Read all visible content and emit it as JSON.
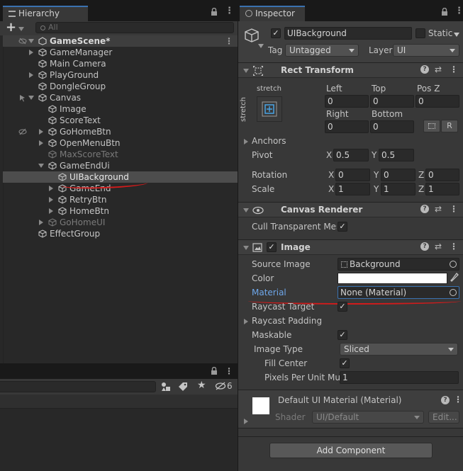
{
  "hierarchy": {
    "tab_label": "Hierarchy",
    "search_placeholder": "All",
    "scene_name": "GameScene*",
    "items": [
      {
        "label": "GameManager"
      },
      {
        "label": "Main Camera"
      },
      {
        "label": "PlayGround"
      },
      {
        "label": "DongleGroup"
      },
      {
        "label": "Canvas"
      },
      {
        "label": "Image"
      },
      {
        "label": "ScoreText"
      },
      {
        "label": "GoHomeBtn"
      },
      {
        "label": "OpenMenuBtn"
      },
      {
        "label": "MaxScoreText"
      },
      {
        "label": "GameEndUi"
      },
      {
        "label": "UIBackground"
      },
      {
        "label": "GameEnd"
      },
      {
        "label": "RetryBtn"
      },
      {
        "label": "HomeBtn"
      },
      {
        "label": "GoHomeUI"
      },
      {
        "label": "EffectGroup"
      }
    ]
  },
  "project": {
    "hidden_count": "6"
  },
  "inspector": {
    "tab_label": "Inspector",
    "object_name": "UIBackground",
    "static_label": "Static",
    "tag_label": "Tag",
    "tag_value": "Untagged",
    "layer_label": "Layer",
    "layer_value": "UI",
    "rect_transform": {
      "title": "Rect Transform",
      "anchor_preset_top": "stretch",
      "anchor_preset_side": "stretch",
      "left_label": "Left",
      "left": "0",
      "top_label": "Top",
      "top": "0",
      "posz_label": "Pos Z",
      "posz": "0",
      "right_label": "Right",
      "right": "0",
      "bottom_label": "Bottom",
      "bottom": "0",
      "r_button": "R",
      "anchors_label": "Anchors",
      "pivot_label": "Pivot",
      "pivot_x": "0.5",
      "pivot_y": "0.5",
      "rotation_label": "Rotation",
      "rot_x": "0",
      "rot_y": "0",
      "rot_z": "0",
      "scale_label": "Scale",
      "scale_x": "1",
      "scale_y": "1",
      "scale_z": "1",
      "axis_x": "X",
      "axis_y": "Y",
      "axis_z": "Z"
    },
    "canvas_renderer": {
      "title": "Canvas Renderer",
      "cull_label": "Cull Transparent Mes"
    },
    "image": {
      "title": "Image",
      "source_label": "Source Image",
      "source_value": "Background",
      "color_label": "Color",
      "material_label": "Material",
      "material_value": "None (Material)",
      "raycast_target_label": "Raycast Target",
      "raycast_padding_label": "Raycast Padding",
      "maskable_label": "Maskable",
      "image_type_label": "Image Type",
      "image_type_value": "Sliced",
      "fill_center_label": "Fill Center",
      "ppu_label": "Pixels Per Unit Mul",
      "ppu_value": "1"
    },
    "material_preview": {
      "title": "Default UI Material (Material)",
      "shader_label": "Shader",
      "shader_value": "UI/Default",
      "edit_label": "Edit..."
    },
    "add_component": "Add Component"
  },
  "colors": {
    "selection": "#4d4d4d",
    "accent_tab": "#3a72b0",
    "annotation": "#d21b1b",
    "material_link": "#6ea7ea"
  }
}
